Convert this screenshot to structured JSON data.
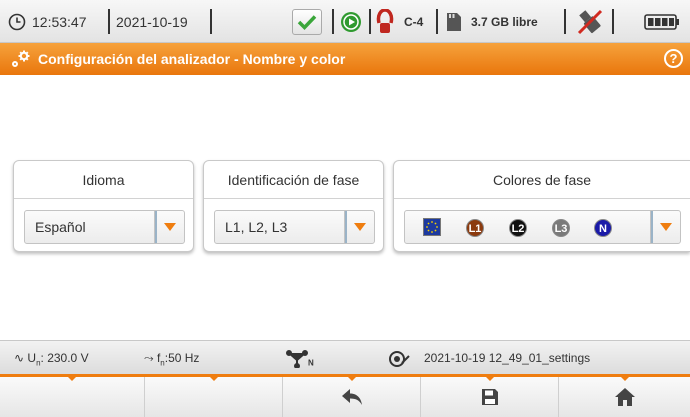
{
  "status": {
    "time": "12:53:47",
    "date": "2021-10-19",
    "clamp": "C-4",
    "storage": "3.7 GB libre"
  },
  "header": {
    "title": "Configuración del analizador - Nombre y color",
    "help": "?"
  },
  "panels": {
    "language": {
      "title": "Idioma",
      "value": "Español"
    },
    "phase_id": {
      "title": "Identificación de fase",
      "value": "L1, L2, L3"
    },
    "phase_colors": {
      "title": "Colores de fase",
      "phases": [
        {
          "label": "L1",
          "color": "#8b3a0e"
        },
        {
          "label": "L2",
          "color": "#111111"
        },
        {
          "label": "L3",
          "color": "#7a7a7a"
        },
        {
          "label": "N",
          "color": "#1a1aa8"
        }
      ]
    }
  },
  "infobar": {
    "voltage_symbol": "U",
    "voltage_sub": "n",
    "voltage_value": ": 230.0 V",
    "freq_symbol": "f",
    "freq_sub": "n",
    "freq_value": ":50 Hz",
    "topology_sub": "N",
    "settings_file": "2021-10-19 12_49_01_settings"
  },
  "fkeys": [
    "",
    "",
    "back-icon",
    "save-icon",
    "home-icon"
  ],
  "colors": {
    "accent": "#ef7d0f",
    "ok_green": "#3aa63a"
  }
}
